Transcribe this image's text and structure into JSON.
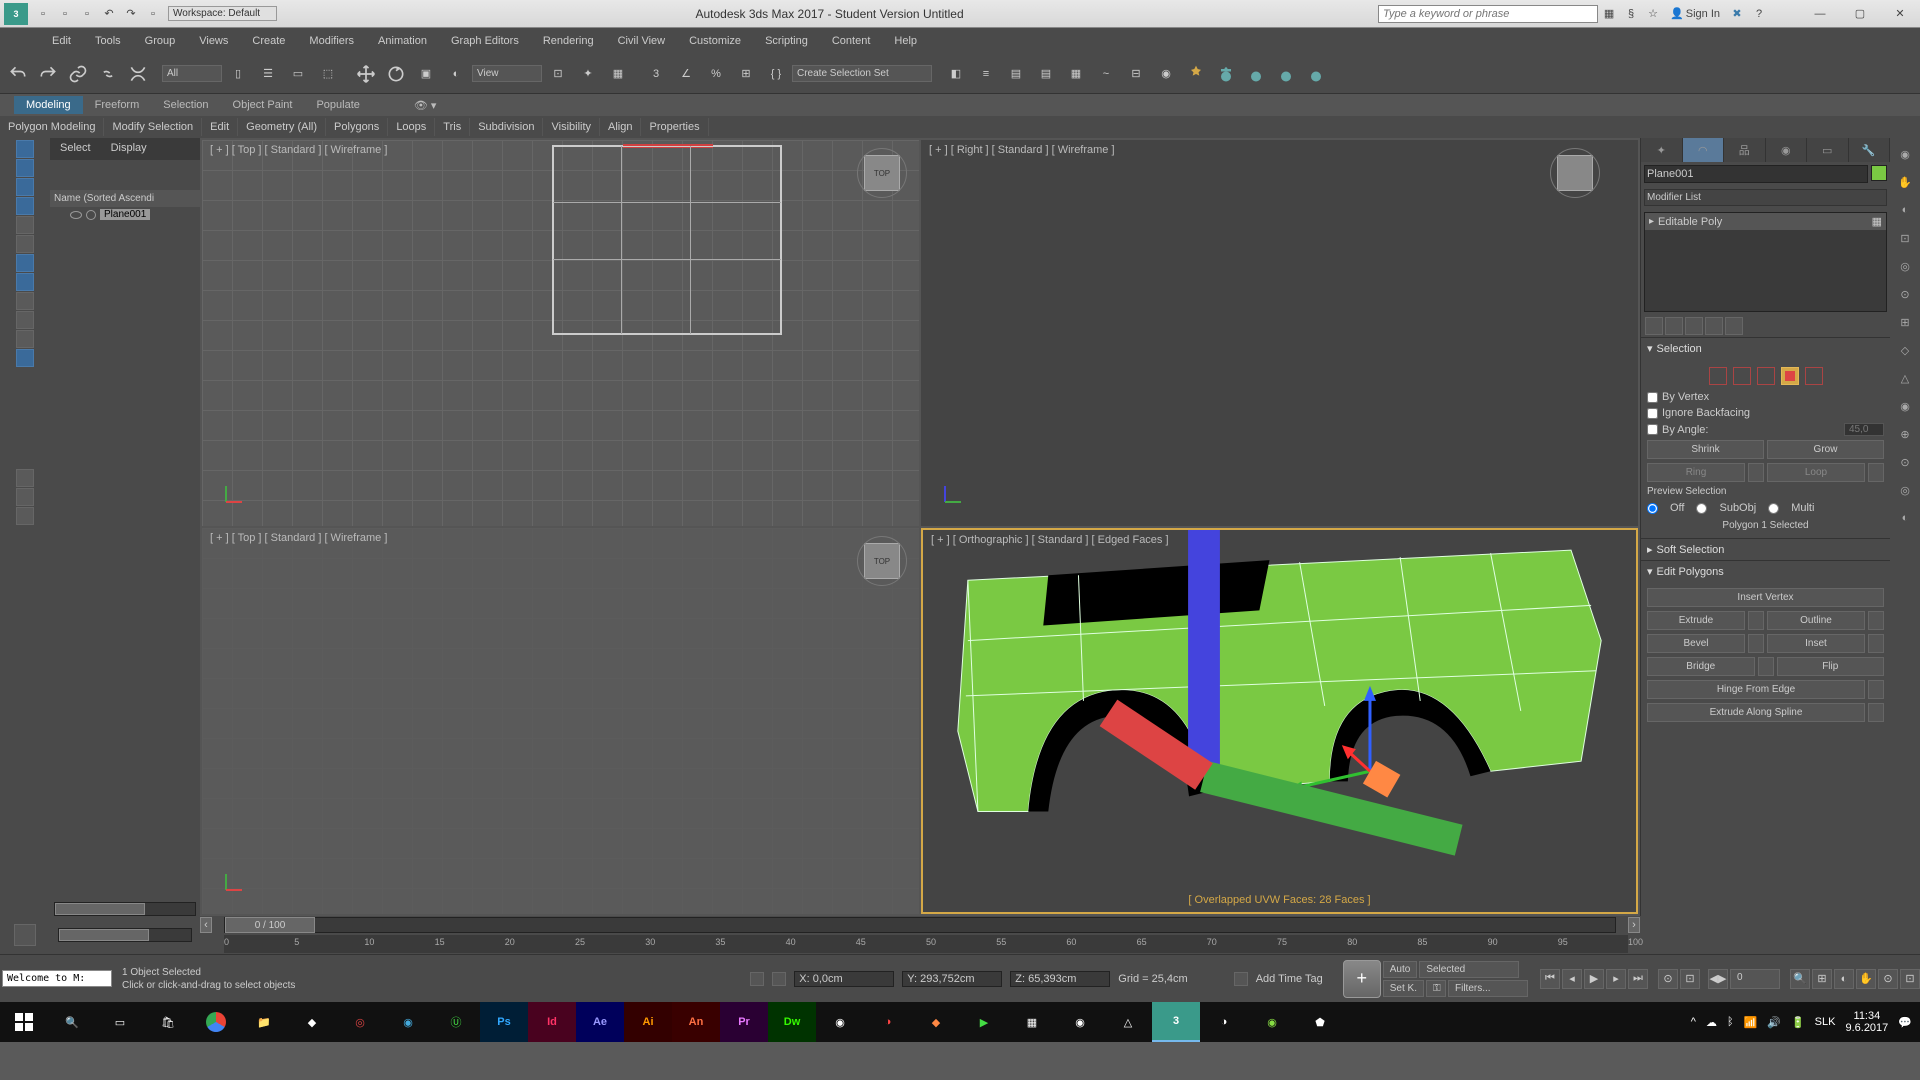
{
  "titlebar": {
    "workspace_label": "Workspace: Default",
    "title": "Autodesk 3ds Max 2017 - Student Version    Untitled",
    "search_placeholder": "Type a keyword or phrase",
    "signin": "Sign In"
  },
  "menubar": [
    "Edit",
    "Tools",
    "Group",
    "Views",
    "Create",
    "Modifiers",
    "Animation",
    "Graph Editors",
    "Rendering",
    "Civil View",
    "Customize",
    "Scripting",
    "Content",
    "Help"
  ],
  "toolbar": {
    "filter_dd": "All",
    "view_dd": "View",
    "selset_dd": "Create Selection Set"
  },
  "ribbon_tabs": [
    "Modeling",
    "Freeform",
    "Selection",
    "Object Paint",
    "Populate"
  ],
  "ribbon_active": 0,
  "subribbon": [
    "Polygon Modeling",
    "Modify Selection",
    "Edit",
    "Geometry (All)",
    "Polygons",
    "Loops",
    "Tris",
    "Subdivision",
    "Visibility",
    "Align",
    "Properties"
  ],
  "scene": {
    "tabs": [
      "Select",
      "Display"
    ],
    "header": "Name (Sorted Ascendi",
    "items": [
      {
        "label": "Plane001"
      }
    ]
  },
  "viewports": {
    "vp0": "[ + ] [ Top ]  [ Standard ] [ Wireframe ]",
    "vp1": "[ + ] [ Right ]  [ Standard ] [ Wireframe ]",
    "vp2": "[ + ] [ Top ]  [ Standard ] [ Wireframe ]",
    "vp3": "[ + ] [ Orthographic ]  [ Standard ] [ Edged Faces ]",
    "warn": "[ Overlapped UVW Faces: 28 Faces ]"
  },
  "right": {
    "objname": "Plane001",
    "modifier_list": "Modifier List",
    "stack0": "Editable Poly",
    "selection": {
      "title": "Selection",
      "by_vertex": "By Vertex",
      "ignore_back": "Ignore Backfacing",
      "by_angle": "By Angle:",
      "angle_val": "45,0",
      "shrink": "Shrink",
      "grow": "Grow",
      "ring": "Ring",
      "loop": "Loop",
      "preview": "Preview Selection",
      "off": "Off",
      "subobj": "SubObj",
      "multi": "Multi",
      "status": "Polygon 1 Selected"
    },
    "soft": {
      "title": "Soft Selection"
    },
    "editpoly": {
      "title": "Edit Polygons",
      "insert_vertex": "Insert Vertex",
      "extrude": "Extrude",
      "outline": "Outline",
      "bevel": "Bevel",
      "inset": "Inset",
      "bridge": "Bridge",
      "flip": "Flip",
      "hinge": "Hinge From Edge",
      "extrude_spline": "Extrude Along Spline"
    }
  },
  "timeline": {
    "frames": "0 / 100",
    "ticks": [
      "0",
      "5",
      "10",
      "15",
      "20",
      "25",
      "30",
      "35",
      "40",
      "45",
      "50",
      "55",
      "60",
      "65",
      "70",
      "75",
      "80",
      "85",
      "90",
      "95",
      "100"
    ]
  },
  "status": {
    "selected": "1 Object Selected",
    "hint": "Click or click-and-drag to select objects",
    "macro": "Welcome to M:",
    "x": "X: 0,0cm",
    "y": "Y: 293,752cm",
    "z": "Z: 65,393cm",
    "grid": "Grid = 25,4cm",
    "add_tag": "Add Time Tag",
    "auto": "Auto",
    "selected_dd": "Selected",
    "setk": "Set K.",
    "filters": "Filters...",
    "frame": "0"
  },
  "taskbar": {
    "lang": "SLK",
    "time": "11:34",
    "date": "9.6.2017"
  }
}
